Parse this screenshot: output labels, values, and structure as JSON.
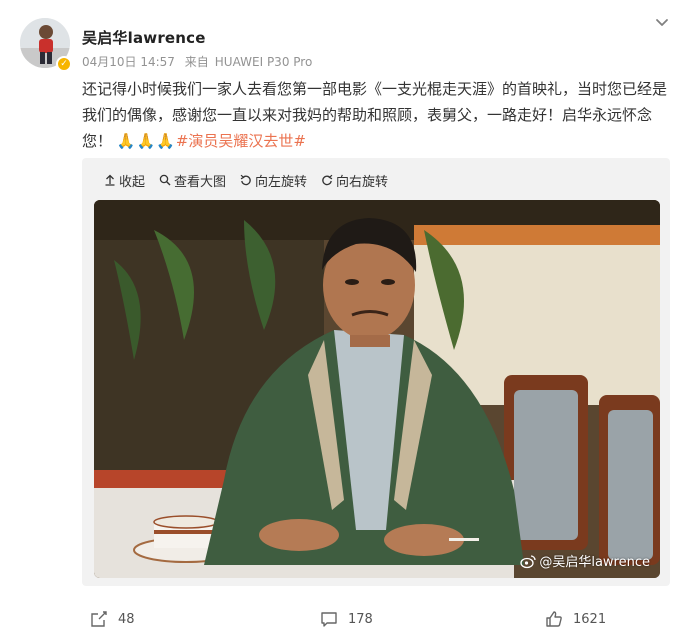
{
  "user": {
    "name": "吴启华lawrence",
    "verified_mark": "✓"
  },
  "meta": {
    "date": "04月10日 14:57",
    "source_prefix": "来自",
    "device": "HUAWEI P30 Pro"
  },
  "post": {
    "text": "还记得小时候我们一家人去看您第一部电影《一支光棍走天涯》的首映礼，当时您已经是我们的偶像，感谢您一直以来对我妈的帮助和照顾，表舅父，一路走好！启华永远怀念您！",
    "emoji": "🙏🙏🙏",
    "hashtag": "#演员吴耀汉去世#"
  },
  "media_toolbar": {
    "collapse_label": "收起",
    "view_large_label": "查看大图",
    "rotate_left_label": "向左旋转",
    "rotate_right_label": "向右旋转"
  },
  "photo": {
    "watermark_text": "@吴启华lawrence"
  },
  "actions": {
    "share_count": "48",
    "comment_count": "178",
    "like_count": "1621"
  },
  "colors": {
    "hashtag": "#eb7350",
    "verified_badge": "#f7b500",
    "meta_text": "#939393"
  },
  "icons": [
    "chevron-down-icon",
    "collapse-arrow-icon",
    "magnifier-icon",
    "rotate-left-icon",
    "rotate-right-icon",
    "weibo-logo-icon",
    "share-icon",
    "comment-icon",
    "like-icon"
  ]
}
